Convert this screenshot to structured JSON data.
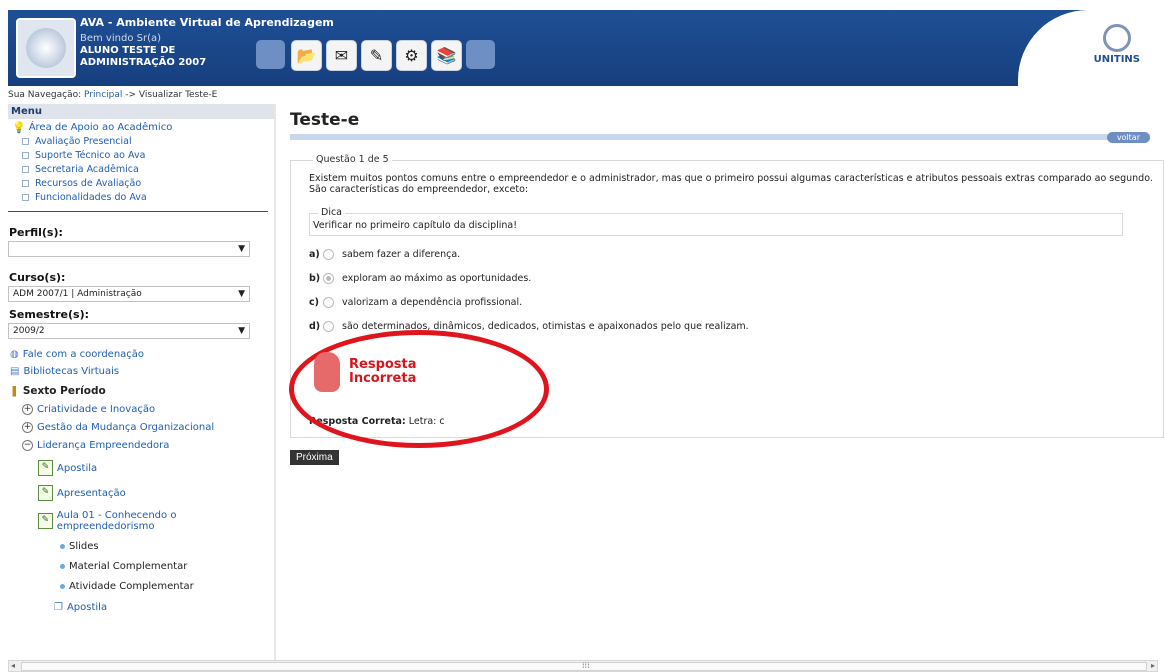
{
  "header": {
    "app_title": "AVA - Ambiente Virtual de Aprendizagem",
    "welcome": "Bem vindo Sr(a)",
    "user_name": "ALUNO TESTE DE ADMINISTRAÇÃO 2007",
    "brand": "UNITINS",
    "toolbar_icons": [
      "toolbar-blank-1-icon",
      "folders-icon",
      "mail-icon",
      "tools-icon",
      "settings-icon",
      "books-icon",
      "toolbar-blank-2-icon"
    ]
  },
  "breadcrumb": {
    "prefix": "Sua Navegação:",
    "home": "Principal",
    "arrow": "->",
    "current": "Visualizar Teste-E"
  },
  "sidebar": {
    "menu_title": "Menu",
    "support_area": "Área de Apoio ao Acadêmico",
    "items": [
      "Avaliação Presencial",
      "Suporte Técnico ao Ava",
      "Secretaria Acadêmica",
      "Recursos de Avaliação",
      "Funcionalidades do Ava"
    ],
    "profile_label": "Perfil(s):",
    "profile_value": "",
    "course_label": "Curso(s):",
    "course_value": "ADM 2007/1 | Administração",
    "semester_label": "Semestre(s):",
    "semester_value": "2009/2",
    "contact": "Fale com a coordenação",
    "libraries": "Bibliotecas Virtuais",
    "period": "Sexto Período",
    "tree": {
      "course1": "Criatividade e Inovação",
      "course2": "Gestão da Mudança Organizacional",
      "course3": "Liderança Empreendedora",
      "apostila": "Apostila",
      "apresentacao": "Apresentação",
      "aula": "Aula 01 - Conhecendo o empreendedorismo",
      "slides": "Slides",
      "material": "Material Complementar",
      "atividade": "Atividade Complementar",
      "apostila2": "Apostila"
    }
  },
  "main": {
    "title": "Teste-e",
    "back": "voltar",
    "question_legend": "Questão 1 de 5",
    "question_text": "Existem muitos pontos comuns entre o empreendedor e o administrador, mas que o primeiro possui algumas características e atributos pessoais extras comparado ao segundo. São características do empreendedor, exceto:",
    "tip_legend": "Dica",
    "tip_text": "Verificar no primeiro capítulo da disciplina!",
    "options": [
      {
        "letter": "a)",
        "text": "sabem fazer a diferença.",
        "selected": false
      },
      {
        "letter": "b)",
        "text": "exploram ao máximo as oportunidades.",
        "selected": true
      },
      {
        "letter": "c)",
        "text": "valorizam a dependência profissional.",
        "selected": false
      },
      {
        "letter": "d)",
        "text": "são determinados, dinâmicos, dedicados, otimistas e apaixonados pelo que realizam.",
        "selected": false
      }
    ],
    "result_line1": "Resposta",
    "result_line2": "Incorreta",
    "correct_label": "Resposta Correta:",
    "correct_value": "Letra: c",
    "next": "Próxima",
    "accent": "#e0141c"
  },
  "colors": {
    "header_bg": "#1f4f95",
    "link": "#1f5fb0",
    "title_bar": "#c9d7ec"
  }
}
